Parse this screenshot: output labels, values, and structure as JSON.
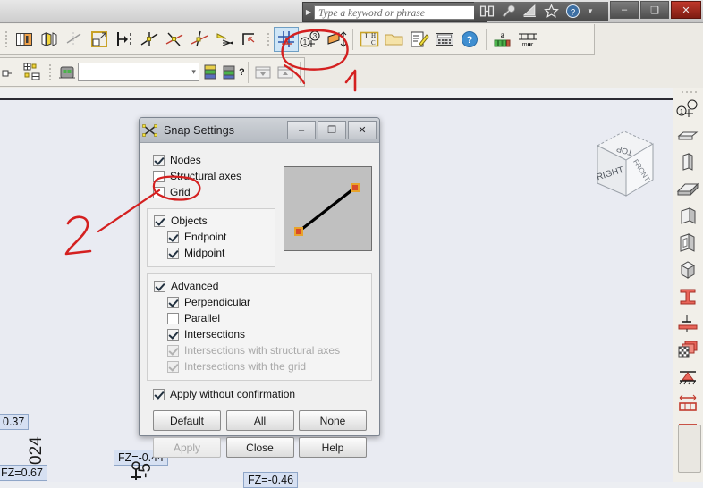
{
  "window": {
    "quick_search_placeholder": "Type a keyword or phrase",
    "quick_search_value": "",
    "minimize_label": "–",
    "maximize_label": "❑",
    "close_label": "✕",
    "sub_minimize_label": "–",
    "sub_restore_label": "❐",
    "sub_close_label": "✕",
    "quick_access_icons": [
      "binoculars-icon",
      "wrench-icon",
      "printer-icon",
      "star-icon",
      "help-icon",
      "dropdown-arrow-icon"
    ]
  },
  "toolbar_top": {
    "items": [
      {
        "name": "layer-display-icon",
        "selected": false
      },
      {
        "name": "wall-panel-icon",
        "selected": false
      },
      {
        "name": "snap-off-icon",
        "selected": false
      },
      {
        "name": "selection-box-icon",
        "selected": false
      },
      {
        "name": "align-right-icon",
        "selected": false
      },
      {
        "name": "node-snap-icon",
        "selected": false
      },
      {
        "name": "axes-snap-icon",
        "selected": false
      },
      {
        "name": "object-snap-icon",
        "selected": false
      },
      {
        "name": "mesh-snap-icon",
        "selected": false
      },
      {
        "name": "corner-snap-icon",
        "selected": false
      },
      {
        "name": "snap-settings-icon",
        "selected": true
      },
      {
        "name": "numbering-icon",
        "selected": false
      },
      {
        "name": "section-cut-icon",
        "selected": false
      },
      {
        "name": "label-display-icon",
        "selected": false
      },
      {
        "name": "open-folder-icon",
        "selected": false
      },
      {
        "name": "edit-report-icon",
        "selected": false
      },
      {
        "name": "calculator-icon",
        "selected": false
      },
      {
        "name": "help-circle-icon",
        "selected": false
      },
      {
        "name": "units-a-icon",
        "selected": false
      },
      {
        "name": "table-units-icon",
        "selected": false
      }
    ]
  },
  "toolbar_second": {
    "items": [
      {
        "name": "structure-tree-icon"
      },
      {
        "name": "grid-view-icon"
      },
      {
        "name": "load-case-icon"
      },
      {
        "name": "load-case-add-icon"
      },
      {
        "name": "load-case-help-icon"
      },
      {
        "name": "table-down-icon"
      },
      {
        "name": "table-up-icon"
      }
    ],
    "combo_value": "",
    "combo_arrow": "▾"
  },
  "dialog": {
    "title": "Snap Settings",
    "title_icon": "snap-cross-icon",
    "minimize_label": "–",
    "maximize_label": "❐",
    "close_label": "✕",
    "options_primary": [
      {
        "label": "Nodes",
        "checked": true,
        "enabled": true,
        "indent": 0,
        "name": "checkbox-nodes"
      },
      {
        "label": "Structural axes",
        "checked": false,
        "enabled": true,
        "indent": 0,
        "name": "checkbox-structural-axes"
      },
      {
        "label": "Grid",
        "checked": false,
        "enabled": true,
        "indent": 0,
        "name": "checkbox-grid"
      }
    ],
    "options_objects": [
      {
        "label": "Objects",
        "checked": true,
        "enabled": true,
        "indent": 0,
        "name": "checkbox-objects"
      },
      {
        "label": "Endpoint",
        "checked": true,
        "enabled": true,
        "indent": 1,
        "name": "checkbox-endpoint"
      },
      {
        "label": "Midpoint",
        "checked": true,
        "enabled": true,
        "indent": 1,
        "name": "checkbox-midpoint"
      }
    ],
    "options_advanced": [
      {
        "label": "Advanced",
        "checked": true,
        "enabled": true,
        "indent": 0,
        "name": "checkbox-advanced"
      },
      {
        "label": "Perpendicular",
        "checked": true,
        "enabled": true,
        "indent": 1,
        "name": "checkbox-perpendicular"
      },
      {
        "label": "Parallel",
        "checked": false,
        "enabled": true,
        "indent": 1,
        "name": "checkbox-parallel"
      },
      {
        "label": "Intersections",
        "checked": true,
        "enabled": true,
        "indent": 1,
        "name": "checkbox-intersections"
      },
      {
        "label": "Intersections with structural axes",
        "checked": true,
        "enabled": false,
        "indent": 1,
        "name": "checkbox-intersections-structural-axes"
      },
      {
        "label": "Intersections with the grid",
        "checked": true,
        "enabled": false,
        "indent": 1,
        "name": "checkbox-intersections-grid"
      }
    ],
    "apply_without_confirmation": {
      "label": "Apply without confirmation",
      "checked": true,
      "name": "checkbox-apply-without-confirmation"
    },
    "buttons": [
      {
        "label": "Default",
        "enabled": true,
        "name": "default-button"
      },
      {
        "label": "All",
        "enabled": true,
        "name": "all-button"
      },
      {
        "label": "None",
        "enabled": true,
        "name": "none-button"
      },
      {
        "label": "Apply",
        "enabled": false,
        "name": "apply-button"
      },
      {
        "label": "Close",
        "enabled": true,
        "name": "close-button"
      },
      {
        "label": "Help",
        "enabled": true,
        "name": "help-button"
      }
    ],
    "preview": {
      "name": "snap-preview-line",
      "line_color": "#000000",
      "node_color": "#e8a32b",
      "node_fill": "#d94a28"
    }
  },
  "viewcube": {
    "face_top": "TOP",
    "face_left": "RIGHT",
    "face_right": "FRONT"
  },
  "viewport_labels": [
    {
      "text": "0.37",
      "name": "result-label-0-37"
    },
    {
      "text": "FZ=0.67",
      "name": "result-label-fz-067"
    },
    {
      "text": "FZ=-0.44",
      "name": "result-label-fz-044"
    },
    {
      "text": "FZ=-0.46",
      "name": "result-label-fz-046"
    },
    {
      "text": "024",
      "name": "rotated-result-label-024"
    },
    {
      "text": "-5",
      "name": "rotated-result-label-5"
    }
  ],
  "annotations": [
    {
      "text": "1",
      "name": "annotation-number-1",
      "color": "#d42020"
    },
    {
      "text": "2",
      "name": "annotation-number-2",
      "color": "#d42020"
    }
  ],
  "colors": {
    "annotation_red": "#d42020",
    "selection_blue": "#cfe6f7",
    "label_blue": "#d6e0f2",
    "viewport_bg": "#e9ebf2"
  }
}
